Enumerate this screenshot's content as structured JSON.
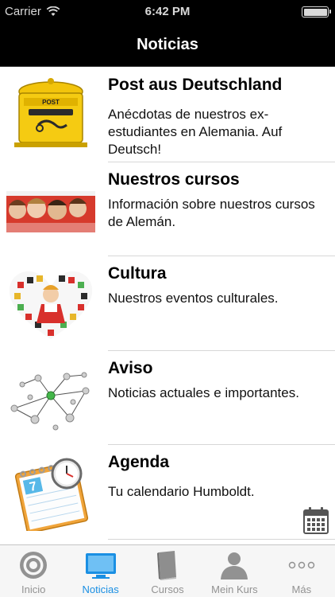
{
  "status_bar": {
    "carrier": "Carrier",
    "time": "6:42 PM"
  },
  "nav": {
    "title": "Noticias"
  },
  "items": [
    {
      "title": "Post aus Deutschland",
      "description": "Anécdotas de nuestros ex-estudiantes en Alemania. Auf Deutsch!",
      "icon": "post-box-icon"
    },
    {
      "title": "Nuestros cursos",
      "description": "Información sobre nuestros cursos de Alemán.",
      "icon": "students-photo-icon"
    },
    {
      "title": "Cultura",
      "description": "Nuestros eventos culturales.",
      "icon": "culture-heart-icon"
    },
    {
      "title": "Aviso",
      "description": "Noticias actuales e importantes.",
      "icon": "network-icon"
    },
    {
      "title": "Agenda",
      "description": "Tu calendario Humboldt.",
      "icon": "calendar-clock-icon"
    }
  ],
  "tabs": [
    {
      "label": "Inicio",
      "icon": "target-icon",
      "active": false
    },
    {
      "label": "Noticias",
      "icon": "monitor-icon",
      "active": true
    },
    {
      "label": "Cursos",
      "icon": "book-icon",
      "active": false
    },
    {
      "label": "Mein Kurs",
      "icon": "person-icon",
      "active": false
    },
    {
      "label": "Más",
      "icon": "more-dots-icon",
      "active": false
    }
  ],
  "colors": {
    "accent": "#1a8fe3",
    "bar": "#000000",
    "inactive": "#929292"
  }
}
